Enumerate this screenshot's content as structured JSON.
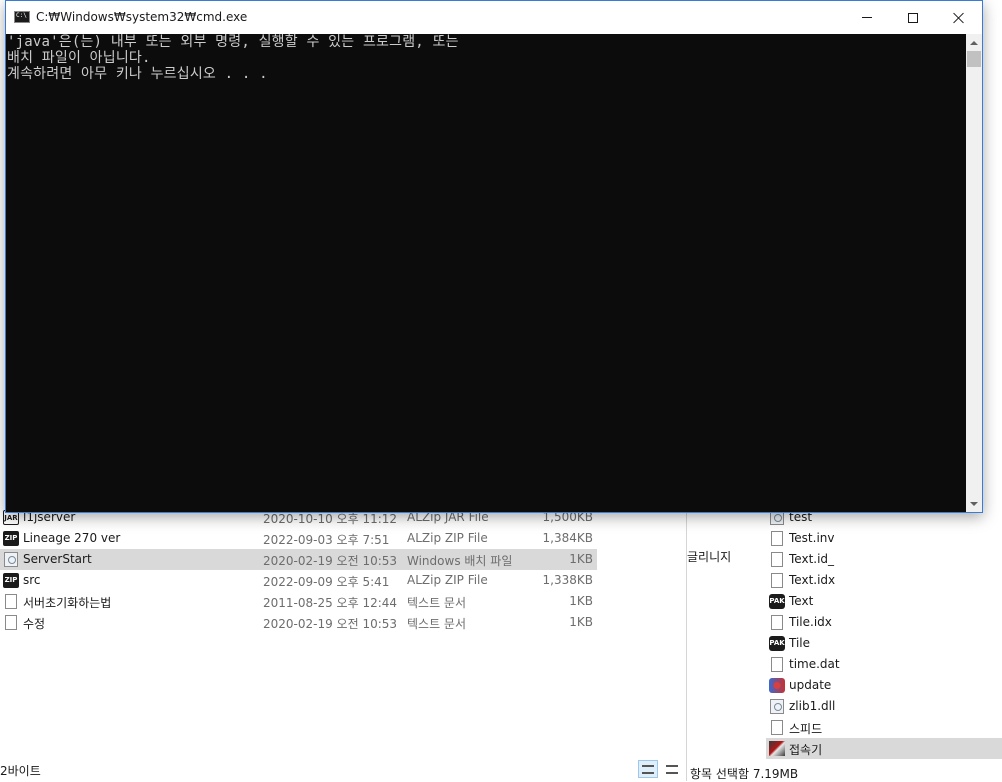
{
  "cmd": {
    "title": "C:₩Windows₩system32₩cmd.exe",
    "console_lines": [
      "'java'은(는) 내부 또는 외부 명령, 실행할 수 있는 프로그램, 또는",
      "배치 파일이 아닙니다.",
      "계속하려면 아무 키나 누르십시오 . . ."
    ],
    "colors": {
      "background": "#0c0c0c",
      "text": "#cccccc",
      "accent_border": "#3a7bd5"
    }
  },
  "explorer_left": {
    "files": [
      {
        "name": "l1jserver",
        "date": "2020-10-10 오후 11:12",
        "type": "ALZip JAR File",
        "size": "1,500KB",
        "icon": "jar-icon",
        "icon_text": "JAR"
      },
      {
        "name": "Lineage 270 ver",
        "date": "2022-09-03 오후 7:51",
        "type": "ALZip ZIP File",
        "size": "1,384KB",
        "icon": "zip-icon",
        "icon_text": "ZIP"
      },
      {
        "name": "ServerStart",
        "date": "2020-02-19 오전 10:53",
        "type": "Windows 배치 파일",
        "size": "1KB",
        "icon": "batch-file-icon",
        "icon_text": "",
        "selected": true
      },
      {
        "name": "src",
        "date": "2022-09-09 오후 5:41",
        "type": "ALZip ZIP File",
        "size": "1,338KB",
        "icon": "zip-icon",
        "icon_text": "ZIP"
      },
      {
        "name": "서버초기화하는법",
        "date": "2011-08-25 오후 12:44",
        "type": "텍스트 문서",
        "size": "1KB",
        "icon": "text-file-icon",
        "icon_text": ""
      },
      {
        "name": "수정",
        "date": "2020-02-19 오전 10:53",
        "type": "텍스트 문서",
        "size": "1KB",
        "icon": "text-file-icon",
        "icon_text": ""
      }
    ],
    "status": "2바이트"
  },
  "explorer_right": {
    "peek_text": "글리니지",
    "files": [
      {
        "name": "test",
        "icon": "batch-file-icon",
        "icon_text": ""
      },
      {
        "name": "Test.inv",
        "icon": "text-file-icon",
        "icon_text": ""
      },
      {
        "name": "Text.id_",
        "icon": "text-file-icon",
        "icon_text": ""
      },
      {
        "name": "Text.idx",
        "icon": "text-file-icon",
        "icon_text": ""
      },
      {
        "name": "Text",
        "icon": "pak-icon",
        "icon_text": "PAK"
      },
      {
        "name": "Tile.idx",
        "icon": "text-file-icon",
        "icon_text": ""
      },
      {
        "name": "Tile",
        "icon": "pak-icon",
        "icon_text": "PAK"
      },
      {
        "name": "time.dat",
        "icon": "text-file-icon",
        "icon_text": ""
      },
      {
        "name": "update",
        "icon": "update-icon",
        "icon_text": ""
      },
      {
        "name": "zlib1.dll",
        "icon": "batch-file-icon",
        "icon_text": ""
      },
      {
        "name": "스피드",
        "icon": "text-file-icon",
        "icon_text": ""
      },
      {
        "name": "접속기",
        "icon": "game-icon",
        "icon_text": "",
        "selected": true
      }
    ],
    "status": "항목 선택함 7.19MB"
  }
}
